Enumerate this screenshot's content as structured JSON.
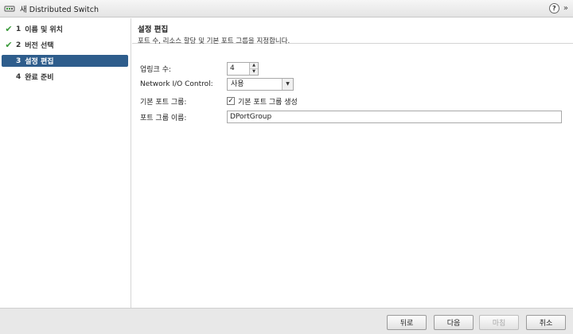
{
  "window": {
    "title": "새 Distributed Switch",
    "help_glyph": "?",
    "expand_glyph": "»"
  },
  "steps": [
    {
      "num": "1",
      "label": "이름 및 위치",
      "done": true
    },
    {
      "num": "2",
      "label": "버전 선택",
      "done": true
    },
    {
      "num": "3",
      "label": "설정 편집",
      "active": true
    },
    {
      "num": "4",
      "label": "완료 준비"
    }
  ],
  "main": {
    "title": "설정 편집",
    "subtitle": "포트 수, 리소스 할당 및 기본 포트 그룹을 지정합니다."
  },
  "form": {
    "uplinks_label": "업링크 수:",
    "uplinks_value": "4",
    "nioc_label": "Network I/O Control:",
    "nioc_value": "사용",
    "default_pg_label": "기본 포트 그룹:",
    "default_pg_checkbox": "기본 포트 그룹 생성",
    "default_pg_checked": true,
    "pg_name_label": "포트 그룹 이름:",
    "pg_name_value": "DPortGroup"
  },
  "buttons": {
    "back": "뒤로",
    "next": "다음",
    "finish": "마침",
    "cancel": "취소"
  }
}
